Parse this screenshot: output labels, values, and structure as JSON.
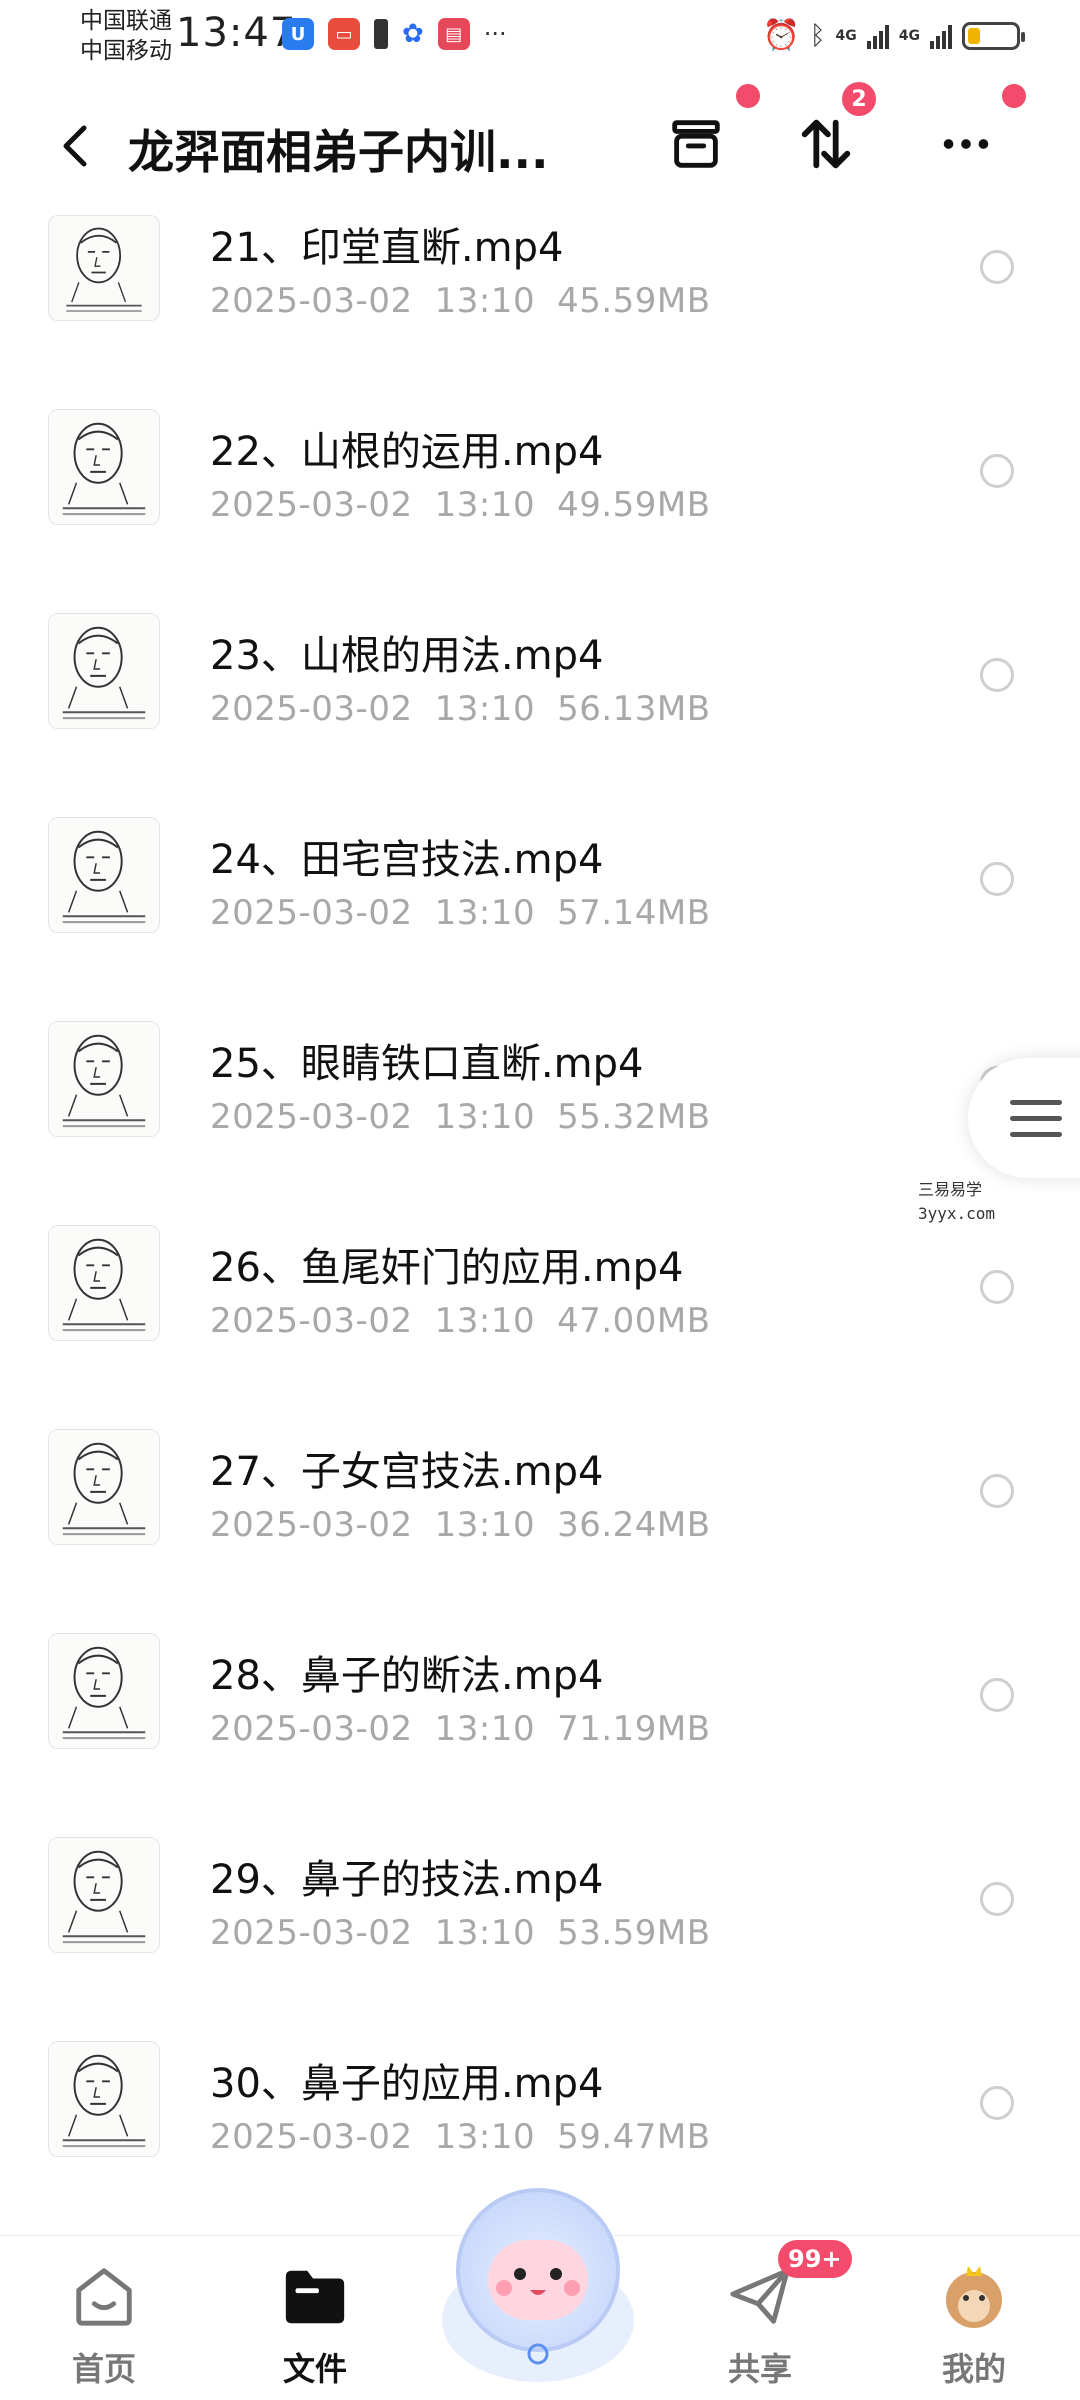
{
  "status_bar": {
    "carrier_1": "中国联通",
    "carrier_2": "中国移动",
    "time": "13:47",
    "network_1": "4G",
    "network_2": "4G",
    "battery_percent": 25
  },
  "header": {
    "title": "龙羿面相弟子内训...",
    "transfer_badge_count": "2"
  },
  "files": [
    {
      "name": "21、印堂直断.mp4",
      "date": "2025-03-02",
      "time": "13:10",
      "size": "45.59MB"
    },
    {
      "name": "22、山根的运用.mp4",
      "date": "2025-03-02",
      "time": "13:10",
      "size": "49.59MB"
    },
    {
      "name": "23、山根的用法.mp4",
      "date": "2025-03-02",
      "time": "13:10",
      "size": "56.13MB"
    },
    {
      "name": "24、田宅宫技法.mp4",
      "date": "2025-03-02",
      "time": "13:10",
      "size": "57.14MB"
    },
    {
      "name": "25、眼睛铁口直断.mp4",
      "date": "2025-03-02",
      "time": "13:10",
      "size": "55.32MB"
    },
    {
      "name": "26、鱼尾奸门的应用.mp4",
      "date": "2025-03-02",
      "time": "13:10",
      "size": "47.00MB"
    },
    {
      "name": "27、子女宫技法.mp4",
      "date": "2025-03-02",
      "time": "13:10",
      "size": "36.24MB"
    },
    {
      "name": "28、鼻子的断法.mp4",
      "date": "2025-03-02",
      "time": "13:10",
      "size": "71.19MB"
    },
    {
      "name": "29、鼻子的技法.mp4",
      "date": "2025-03-02",
      "time": "13:10",
      "size": "53.59MB"
    },
    {
      "name": "30、鼻子的应用.mp4",
      "date": "2025-03-02",
      "time": "13:10",
      "size": "59.47MB"
    }
  ],
  "watermark": {
    "line1": "三易易学",
    "line2": "3yyx.com"
  },
  "bottom_nav": {
    "home": "首页",
    "files": "文件",
    "share": "共享",
    "share_badge": "99+",
    "mine": "我的"
  },
  "colors": {
    "accent": "#f24b6b",
    "meta_text": "#a8a8a8"
  }
}
